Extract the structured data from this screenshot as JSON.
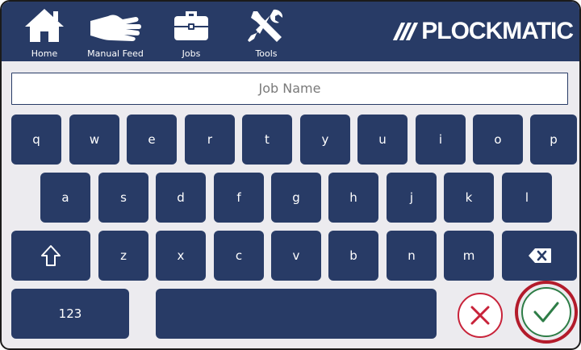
{
  "nav": {
    "home": "Home",
    "manual_feed": "Manual Feed",
    "jobs": "Jobs",
    "tools": "Tools"
  },
  "brand": "PLOCKMATIC",
  "job_name_field": {
    "placeholder": "Job Name",
    "value": ""
  },
  "keyboard": {
    "row1": [
      "q",
      "w",
      "e",
      "r",
      "t",
      "y",
      "u",
      "i",
      "o",
      "p"
    ],
    "row2": [
      "a",
      "s",
      "d",
      "f",
      "g",
      "h",
      "j",
      "k",
      "l"
    ],
    "row3": [
      "z",
      "x",
      "c",
      "v",
      "b",
      "n",
      "m"
    ],
    "numbers_key": "123",
    "shift_icon": "shift-arrow-up-icon",
    "backspace_icon": "backspace-x-icon"
  },
  "actions": {
    "cancel_icon": "x-circle-icon",
    "confirm_icon": "checkmark-circle-icon"
  },
  "colors": {
    "primary": "#283b66",
    "background": "#ecebef",
    "cancel": "#c8233a",
    "confirm": "#2e7d47",
    "confirm_ring": "#b31b2b"
  }
}
